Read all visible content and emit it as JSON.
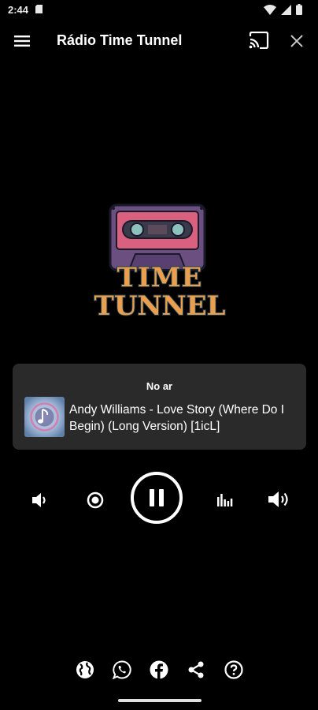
{
  "status_bar": {
    "time": "2:44"
  },
  "app_bar": {
    "title": "Rádio Time Tunnel"
  },
  "logo": {
    "line1": "TIME",
    "line2": "TUNNEL"
  },
  "now_playing": {
    "label": "No ar",
    "track": "Andy Williams - Love Story (Where Do I Begin) (Long Version) [1icL]"
  },
  "colors": {
    "background": "#000000",
    "card": "#2a2a2a",
    "cassette_body": "#7a5a8c",
    "cassette_label": "#d9607e",
    "logo_text": "#e8a050",
    "logo_outline": "#1e3a4a"
  },
  "icons": {
    "menu": "menu-icon",
    "cast": "cast-icon",
    "close": "close-icon",
    "volume_down": "volume-down-icon",
    "record": "record-icon",
    "pause": "pause-icon",
    "equalizer": "equalizer-icon",
    "volume_up": "volume-up-icon",
    "website": "globe-icon",
    "whatsapp": "whatsapp-icon",
    "facebook": "facebook-icon",
    "share": "share-icon",
    "help": "help-icon"
  }
}
